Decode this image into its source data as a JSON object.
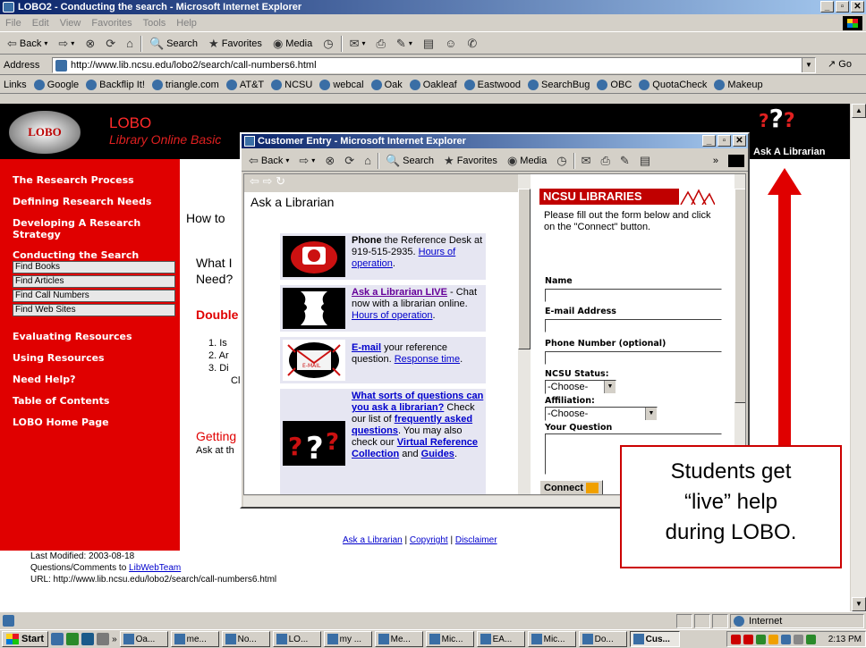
{
  "browser": {
    "title": "LOBO2 - Conducting the search - Microsoft Internet Explorer",
    "menu": [
      "File",
      "Edit",
      "View",
      "Favorites",
      "Tools",
      "Help"
    ],
    "toolbar": [
      "Back",
      "Search",
      "Favorites",
      "Media"
    ],
    "address_label": "Address",
    "url": "http://www.lib.ncsu.edu/lobo2/search/call-numbers6.html",
    "go_label": "Go",
    "links_label": "Links",
    "links": [
      "Google",
      "Backflip It!",
      "triangle.com",
      "AT&T",
      "NCSU",
      "webcal",
      "Oak",
      "Oakleaf",
      "Eastwood",
      "SearchBug",
      "OBC",
      "QuotaCheck",
      "Makeup"
    ],
    "status_zone": "Internet"
  },
  "lobo": {
    "logo_text": "LOBO",
    "title": "LOBO",
    "subtitle": "Library Online Basic",
    "ask_label": "Ask A Librarian",
    "sidebar": {
      "items": [
        "The Research Process",
        "Defining Research Needs",
        "Developing A Research Strategy",
        "Conducting the Search"
      ],
      "subitems": [
        "Find Books",
        "Find Articles",
        "Find Call Numbers",
        "Find Web Sites"
      ],
      "items_after": [
        "Evaluating Resources",
        "Using Resources",
        "Need Help?",
        "Table of Contents",
        "LOBO Home Page"
      ]
    },
    "main": {
      "how_to": "How to",
      "what_i": "What I",
      "need": "Need?",
      "double": "Double",
      "list": [
        "1.  Is",
        "2.  Ar",
        "3.  Di",
        "Cl"
      ],
      "getting": "Getting",
      "ask_at": "Ask at th"
    },
    "footer": {
      "links": [
        "Ask a Librarian",
        "Copyright",
        "Disclaimer"
      ],
      "separator": "|",
      "modified": "Last Modified: 2003-08-18",
      "questions_prefix": "Questions/Comments to ",
      "questions_link": "LibWebTeam",
      "url": "URL: http://www.lib.ncsu.edu/lobo2/search/call-numbers6.html"
    }
  },
  "popup": {
    "title": "Customer Entry - Microsoft Internet Explorer",
    "toolbar": [
      "Back",
      "Search",
      "Favorites",
      "Media"
    ],
    "left": {
      "heading": "Ask a Librarian",
      "phone": {
        "bold": "Phone",
        "text": " the Reference Desk at 919-515-2935. ",
        "link": "Hours of operation",
        "end": "."
      },
      "live": {
        "link": "Ask a Librarian LIVE",
        "text": " - Chat now with a librarian online. ",
        "link2": "Hours of operation",
        "end": "."
      },
      "email": {
        "link": "E-mail",
        "text": " your reference question. ",
        "link2": "Response time",
        "end": "."
      },
      "faq": {
        "link": "What sorts of questions can you ask a librarian?",
        "text": " Check our list of ",
        "link2": "frequently asked questions",
        "text2": ". You may also check our ",
        "link3": "Virtual Reference Collection",
        "text3": " and ",
        "link4": "Guides",
        "end": "."
      },
      "email_icon_text": "E-MAIL"
    },
    "right": {
      "banner": "NCSU LIBRARIES",
      "intro": "Please fill out the form below and click on the \"Connect\" button.",
      "name_label": "Name",
      "email_label": "E-mail Address",
      "phone_label": "Phone Number (optional)",
      "status_label": "NCSU Status:",
      "status_value": "-Choose-",
      "affiliation_label": "Affiliation:",
      "affiliation_value": "-Choose-",
      "question_label": "Your Question",
      "connect_label": "Connect"
    }
  },
  "taskbar": {
    "start": "Start",
    "tasks": [
      "Oa...",
      "me...",
      "No...",
      "LO...",
      "my ...",
      "Me...",
      "Mic...",
      "EA...",
      "Mic...",
      "Do...",
      "Cus..."
    ],
    "time": "2:13 PM"
  },
  "callout": {
    "line1": "Students get",
    "line2": "“live” help",
    "line3": "during LOBO."
  },
  "colors": {
    "lobo_red": "#e00000",
    "callout_border": "#cc0000",
    "titlebar": "#0a246a"
  }
}
